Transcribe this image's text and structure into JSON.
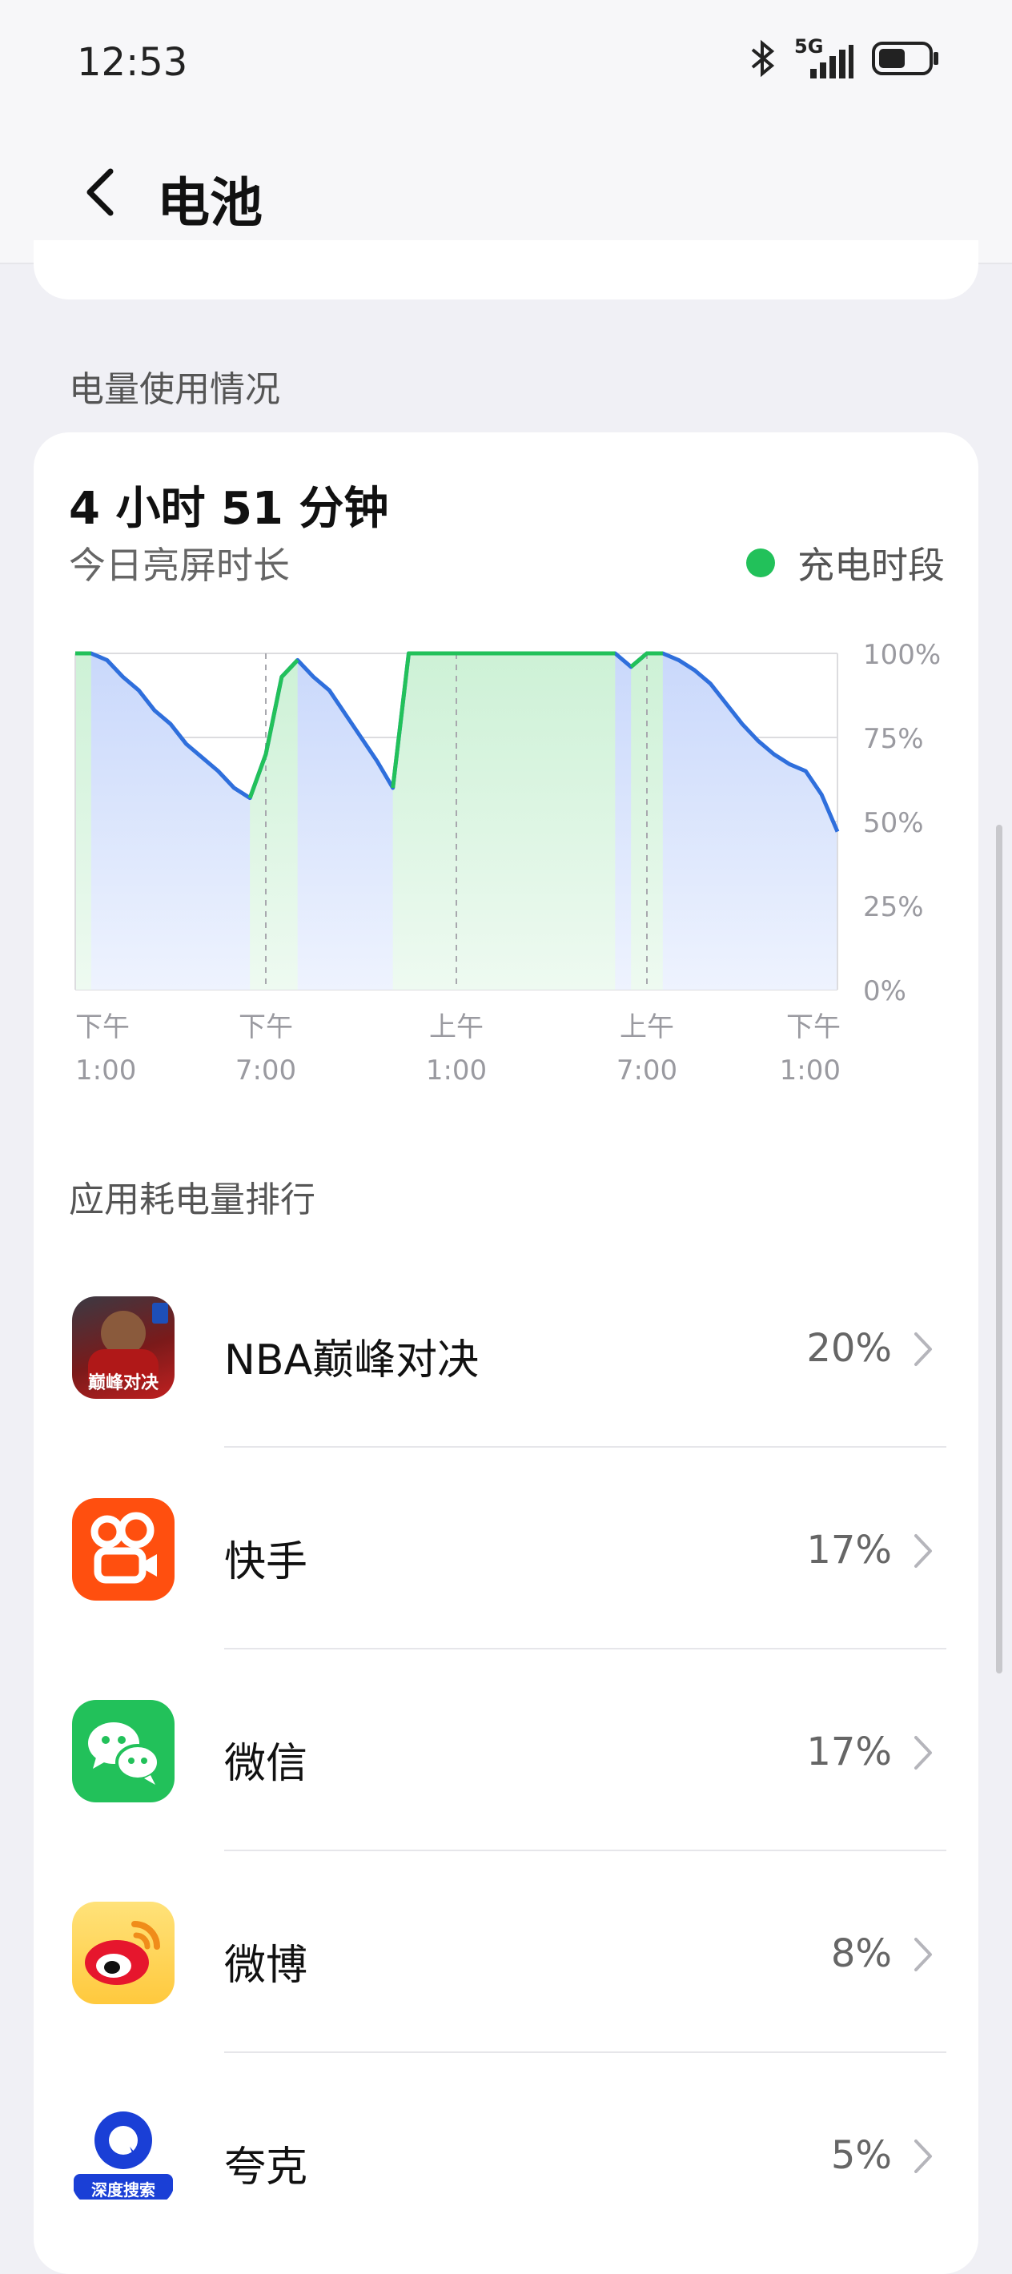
{
  "status_bar": {
    "time": "12:53",
    "network": "5G"
  },
  "header": {
    "title": "电池"
  },
  "usage_section": {
    "label": "电量使用情况",
    "screen_time": "4 小时 51 分钟",
    "screen_time_caption": "今日亮屏时长",
    "legend_label": "充电时段",
    "legend_color": "#22c15a"
  },
  "chart_data": {
    "type": "area",
    "y_ticks": [
      "100%",
      "75%",
      "50%",
      "25%",
      "0%"
    ],
    "ylim": [
      0,
      100
    ],
    "xlim": [
      0,
      24
    ],
    "x_ticks": [
      {
        "x": 0,
        "line1": "下午",
        "line2": "1:00"
      },
      {
        "x": 6,
        "line1": "下午",
        "line2": "7:00"
      },
      {
        "x": 12,
        "line1": "上午",
        "line2": "1:00"
      },
      {
        "x": 18,
        "line1": "上午",
        "line2": "7:00"
      },
      {
        "x": 24,
        "line1": "下午",
        "line2": "1:00"
      }
    ],
    "series": [
      {
        "name": "充电时段",
        "color": "#22c15a",
        "segments": [
          [
            [
              0.0,
              100
            ],
            [
              0.5,
              100
            ]
          ],
          [
            [
              5.5,
              57
            ],
            [
              6.0,
              70
            ],
            [
              6.5,
              93
            ],
            [
              7.0,
              98
            ]
          ],
          [
            [
              10.0,
              60
            ],
            [
              10.5,
              100
            ],
            [
              15.0,
              100
            ],
            [
              16.5,
              100
            ],
            [
              17.0,
              100
            ]
          ],
          [
            [
              17.5,
              96
            ],
            [
              18.0,
              100
            ],
            [
              18.5,
              100
            ]
          ]
        ]
      },
      {
        "name": "battery",
        "color": "#2f6fdc",
        "points": [
          [
            0.0,
            100
          ],
          [
            0.5,
            100
          ],
          [
            1.0,
            98
          ],
          [
            1.5,
            93
          ],
          [
            2.0,
            89
          ],
          [
            2.5,
            83
          ],
          [
            3.0,
            79
          ],
          [
            3.5,
            73
          ],
          [
            4.0,
            69
          ],
          [
            4.5,
            65
          ],
          [
            5.0,
            60
          ],
          [
            5.5,
            57
          ],
          [
            6.0,
            70
          ],
          [
            6.5,
            93
          ],
          [
            7.0,
            98
          ],
          [
            7.5,
            93
          ],
          [
            8.0,
            89
          ],
          [
            8.5,
            82
          ],
          [
            9.0,
            75
          ],
          [
            9.5,
            68
          ],
          [
            10.0,
            60
          ],
          [
            10.5,
            100
          ],
          [
            15.0,
            100
          ],
          [
            16.5,
            100
          ],
          [
            17.0,
            100
          ],
          [
            17.5,
            96
          ],
          [
            18.0,
            100
          ],
          [
            18.5,
            100
          ],
          [
            19.0,
            98
          ],
          [
            19.5,
            95
          ],
          [
            20.0,
            91
          ],
          [
            20.5,
            85
          ],
          [
            21.0,
            79
          ],
          [
            21.5,
            74
          ],
          [
            22.0,
            70
          ],
          [
            22.5,
            67
          ],
          [
            23.0,
            65
          ],
          [
            23.5,
            58
          ],
          [
            24.0,
            47
          ]
        ]
      }
    ],
    "charging_ranges": [
      [
        0.0,
        0.5
      ],
      [
        5.5,
        7.0
      ],
      [
        10.0,
        17.0
      ],
      [
        17.5,
        18.5
      ]
    ]
  },
  "ranking": {
    "label": "应用耗电量排行",
    "apps": [
      {
        "name": "NBA巅峰对决",
        "percent": "20%",
        "icon": "nba-game-icon",
        "icon_text": "巅峰对决"
      },
      {
        "name": "快手",
        "percent": "17%",
        "icon": "kuaishou-icon"
      },
      {
        "name": "微信",
        "percent": "17%",
        "icon": "wechat-icon"
      },
      {
        "name": "微博",
        "percent": "8%",
        "icon": "weibo-icon"
      },
      {
        "name": "夸克",
        "percent": "5%",
        "icon": "quark-icon",
        "icon_text": "深度搜索"
      }
    ]
  }
}
